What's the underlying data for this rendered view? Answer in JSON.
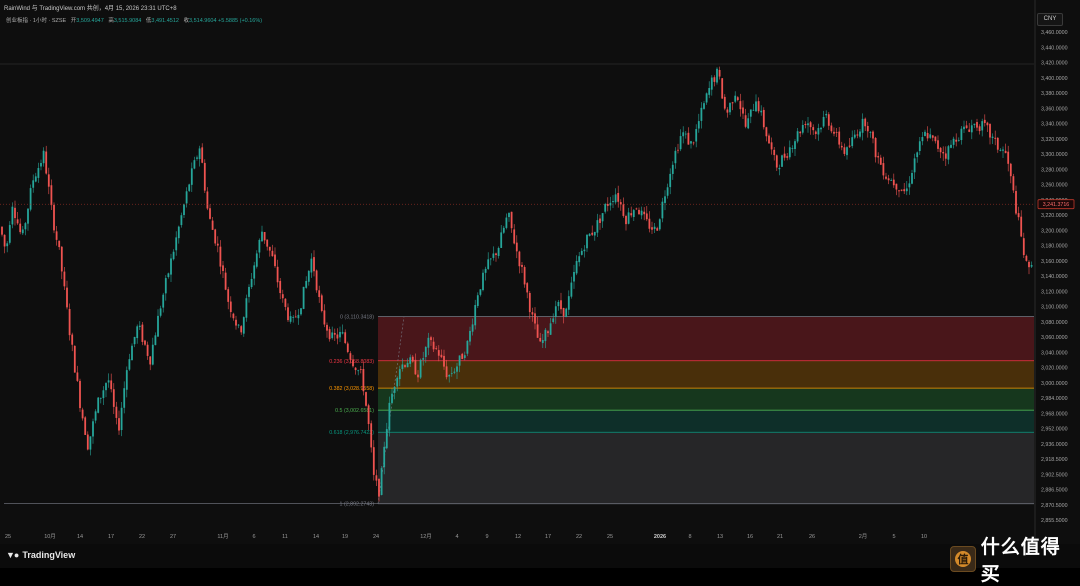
{
  "credit": "RainWind 与 TradingView.com 共创，4月 15, 2026 23:31 UTC+8",
  "ohlc": {
    "symbol": "创业板指 · 1小时 · SZSE",
    "open_label": "开",
    "open": "3,509.4947",
    "high_label": "高",
    "high": "3,515.9084",
    "low_label": "低",
    "low": "3,491.4512",
    "close_label": "收",
    "close": "3,514.9604",
    "change": "+5.5885 (+0.16%)"
  },
  "currency": "CNY",
  "brand": "TradingView",
  "watermark": "什么值得买",
  "colors": {
    "bull": "#26a69a",
    "bear": "#ef5350",
    "price_tag": "#c0392b",
    "background": "#0e0e0e"
  },
  "chart_data": {
    "type": "candlestick",
    "ylim": [
      2850,
      3470
    ],
    "y_ticks": [
      "3,460.0000",
      "3,440.0000",
      "3,420.0000",
      "3,400.0000",
      "3,380.0000",
      "3,360.0000",
      "3,340.0000",
      "3,320.0000",
      "3,300.0000",
      "3,280.0000",
      "3,260.0000",
      "3,240.0000",
      "3,220.0000",
      "3,200.0000",
      "3,180.0000",
      "3,160.0000",
      "3,140.0000",
      "3,120.0000",
      "3,100.0000",
      "3,080.0000",
      "3,060.0000",
      "3,040.0000",
      "3,020.0000",
      "3,000.0000",
      "2,984.0000",
      "2,968.0000",
      "2,952.0000",
      "2,936.0000",
      "2,918.5000",
      "2,902.5000",
      "2,886.5000",
      "2,870.5000",
      "2,855.5000"
    ],
    "x_ticks": [
      "25",
      "10月",
      "14",
      "17",
      "22",
      "27",
      "11月",
      "6",
      "11",
      "14",
      "19",
      "24",
      "12月",
      "4",
      "9",
      "12",
      "17",
      "22",
      "25",
      "2026",
      "8",
      "13",
      "16",
      "21",
      "26",
      "2月",
      "5",
      "10"
    ],
    "last_price": "3,241.3716",
    "last_value": 3241.37,
    "fibonacci": {
      "high": 3110.34,
      "low": 2892.27,
      "levels": [
        {
          "ratio": "0",
          "value": 3110.34,
          "label": "0 (3,110.3418)",
          "color": "#787b86"
        },
        {
          "ratio": "0.236",
          "value": 3058.88,
          "label": "0.236 (3,058.8083)",
          "color": "#f23645"
        },
        {
          "ratio": "0.382",
          "value": 3027.04,
          "label": "0.382 (3,028.9558)",
          "color": "#ff9800"
        },
        {
          "ratio": "0.5",
          "value": 3001.31,
          "label": "0.5 (3,002.6581)",
          "color": "#4caf50"
        },
        {
          "ratio": "0.618",
          "value": 2975.58,
          "label": "0.618 (2,976.7423)",
          "color": "#089981"
        },
        {
          "ratio": "1",
          "value": 2892.27,
          "label": "1 (2,892.2743)",
          "color": "#787b86"
        }
      ]
    },
    "waypoints": [
      [
        0,
        3215
      ],
      [
        6,
        3185
      ],
      [
        12,
        3245
      ],
      [
        22,
        3200
      ],
      [
        33,
        3270
      ],
      [
        44,
        3300
      ],
      [
        52,
        3230
      ],
      [
        60,
        3180
      ],
      [
        70,
        3090
      ],
      [
        80,
        3010
      ],
      [
        88,
        2960
      ],
      [
        98,
        3010
      ],
      [
        108,
        3040
      ],
      [
        118,
        2975
      ],
      [
        128,
        3060
      ],
      [
        138,
        3100
      ],
      [
        150,
        3060
      ],
      [
        160,
        3120
      ],
      [
        170,
        3170
      ],
      [
        180,
        3220
      ],
      [
        190,
        3270
      ],
      [
        200,
        3310
      ],
      [
        208,
        3230
      ],
      [
        218,
        3190
      ],
      [
        228,
        3130
      ],
      [
        240,
        3090
      ],
      [
        252,
        3160
      ],
      [
        262,
        3210
      ],
      [
        272,
        3180
      ],
      [
        282,
        3130
      ],
      [
        292,
        3100
      ],
      [
        302,
        3130
      ],
      [
        312,
        3180
      ],
      [
        322,
        3110
      ],
      [
        332,
        3085
      ],
      [
        342,
        3090
      ],
      [
        352,
        3060
      ],
      [
        362,
        3040
      ],
      [
        368,
        2990
      ],
      [
        374,
        2920
      ],
      [
        380,
        2905
      ],
      [
        384,
        2960
      ],
      [
        390,
        3010
      ],
      [
        398,
        3050
      ],
      [
        408,
        3060
      ],
      [
        418,
        3045
      ],
      [
        428,
        3080
      ],
      [
        438,
        3070
      ],
      [
        448,
        3040
      ],
      [
        458,
        3055
      ],
      [
        468,
        3080
      ],
      [
        478,
        3140
      ],
      [
        488,
        3170
      ],
      [
        498,
        3190
      ],
      [
        508,
        3230
      ],
      [
        516,
        3190
      ],
      [
        524,
        3155
      ],
      [
        532,
        3110
      ],
      [
        540,
        3075
      ],
      [
        548,
        3095
      ],
      [
        556,
        3125
      ],
      [
        566,
        3115
      ],
      [
        576,
        3170
      ],
      [
        586,
        3200
      ],
      [
        596,
        3215
      ],
      [
        606,
        3240
      ],
      [
        616,
        3255
      ],
      [
        626,
        3225
      ],
      [
        636,
        3240
      ],
      [
        646,
        3220
      ],
      [
        656,
        3210
      ],
      [
        664,
        3250
      ],
      [
        672,
        3290
      ],
      [
        682,
        3325
      ],
      [
        692,
        3310
      ],
      [
        702,
        3350
      ],
      [
        712,
        3385
      ],
      [
        718,
        3395
      ],
      [
        726,
        3345
      ],
      [
        736,
        3375
      ],
      [
        746,
        3330
      ],
      [
        756,
        3365
      ],
      [
        766,
        3325
      ],
      [
        776,
        3285
      ],
      [
        786,
        3300
      ],
      [
        796,
        3320
      ],
      [
        806,
        3340
      ],
      [
        816,
        3325
      ],
      [
        826,
        3345
      ],
      [
        836,
        3320
      ],
      [
        846,
        3300
      ],
      [
        856,
        3325
      ],
      [
        866,
        3340
      ],
      [
        876,
        3300
      ],
      [
        886,
        3275
      ],
      [
        896,
        3265
      ],
      [
        906,
        3255
      ],
      [
        916,
        3300
      ],
      [
        926,
        3325
      ],
      [
        936,
        3310
      ],
      [
        946,
        3300
      ],
      [
        956,
        3320
      ],
      [
        966,
        3330
      ],
      [
        976,
        3335
      ],
      [
        986,
        3330
      ],
      [
        996,
        3310
      ],
      [
        1006,
        3300
      ],
      [
        1014,
        3250
      ],
      [
        1020,
        3210
      ],
      [
        1026,
        3170
      ],
      [
        1031,
        3160
      ],
      [
        1034,
        3241
      ]
    ]
  }
}
